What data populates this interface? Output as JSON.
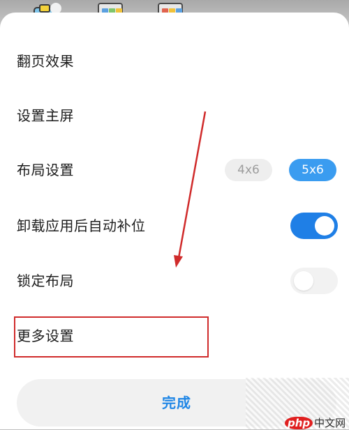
{
  "menu": {
    "page_turn_effect": "翻页效果",
    "set_home_screen": "设置主屏",
    "layout_settings": "布局设置",
    "auto_fill_after_uninstall": "卸载应用后自动补位",
    "lock_layout": "锁定布局",
    "more_settings": "更多设置"
  },
  "layout_options": {
    "option_4x6": "4x6",
    "option_5x6": "5x6",
    "selected": "5x6"
  },
  "toggles": {
    "auto_fill_after_uninstall": true,
    "lock_layout": false
  },
  "done_label": "完成",
  "watermark": {
    "brand": "php",
    "site": "中文网"
  },
  "colors": {
    "accent": "#1f7fe6",
    "chip_selected": "#3a9cf0",
    "annotation_red": "#d02b2b"
  }
}
